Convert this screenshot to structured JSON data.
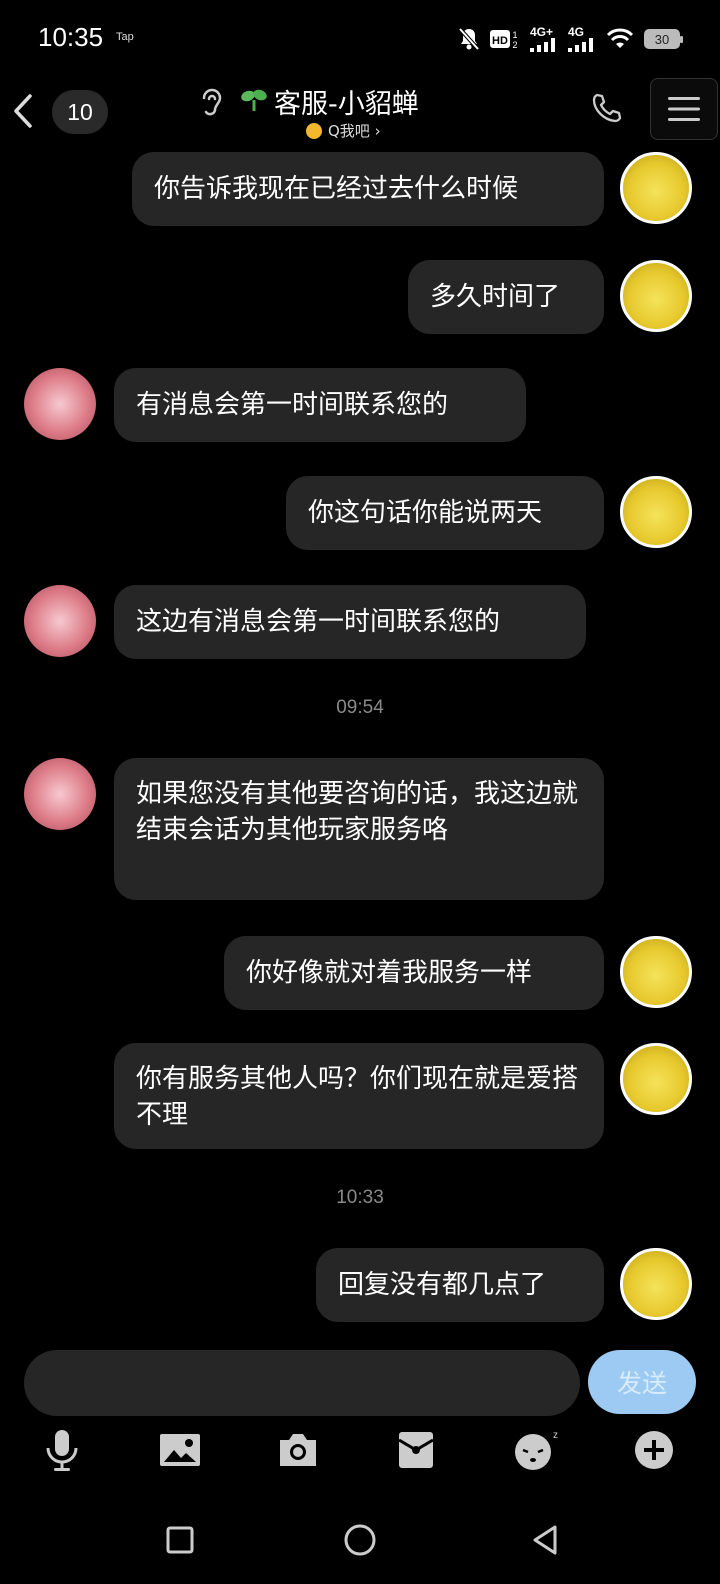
{
  "status_bar": {
    "time": "10:35",
    "carrier_tag": "Tap",
    "network1": "4G+",
    "network2": "4G",
    "battery": "30"
  },
  "header": {
    "unread_count": "10",
    "title": "客服-小貂蝉",
    "subtitle": "Q我吧 ›"
  },
  "messages": [
    {
      "from": "self",
      "text": "你告诉我现在已经过去什么时候"
    },
    {
      "from": "self",
      "text": "多久时间了"
    },
    {
      "from": "agent",
      "text": "有消息会第一时间联系您的"
    },
    {
      "from": "self",
      "text": "你这句话你能说两天"
    },
    {
      "from": "agent",
      "text": "这边有消息会第一时间联系您的"
    },
    {
      "type": "time",
      "text": "09:54"
    },
    {
      "from": "agent",
      "text": "如果您没有其他要咨询的话，我这边就结束会话为其他玩家服务咯"
    },
    {
      "from": "self",
      "text": "你好像就对着我服务一样"
    },
    {
      "from": "self",
      "text": "你有服务其他人吗？你们现在就是爱搭不理"
    },
    {
      "type": "time",
      "text": "10:33"
    },
    {
      "from": "self",
      "text": "回复没有都几点了"
    }
  ],
  "input": {
    "value": "",
    "send_label": "发送"
  },
  "colors": {
    "background": "#000000",
    "bubble": "#262626",
    "send_button": "#9ccaf2",
    "timestamp": "#8a8a8a"
  }
}
